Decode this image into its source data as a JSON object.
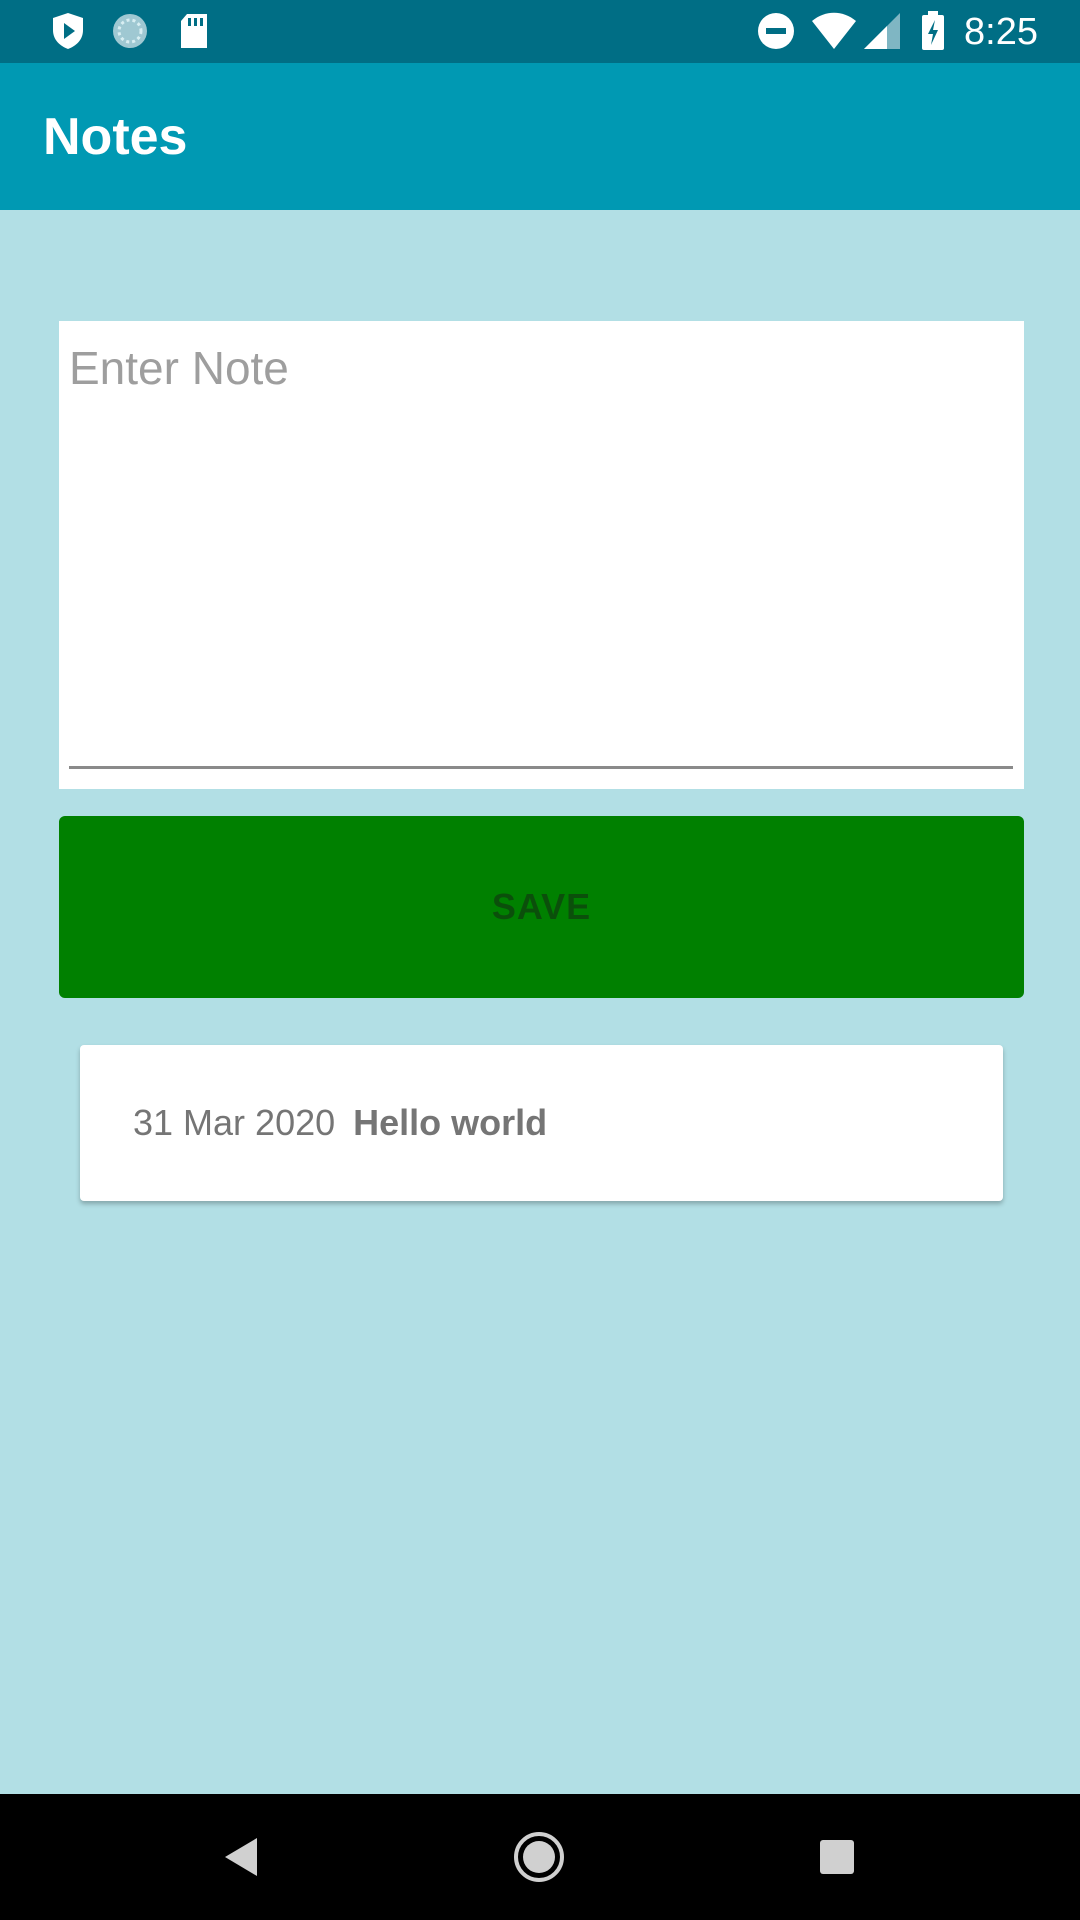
{
  "status_bar": {
    "time": "8:25",
    "left_icons": [
      "play-protect-icon",
      "sync-icon",
      "sd-card-icon"
    ],
    "right_icons": [
      "do-not-disturb-icon",
      "wifi-icon",
      "signal-icon",
      "battery-charging-icon"
    ]
  },
  "app_bar": {
    "title": "Notes"
  },
  "note_input": {
    "placeholder": "Enter Note",
    "value": ""
  },
  "save_button": {
    "label": "SAVE"
  },
  "notes_list": {
    "items": [
      {
        "date": "31 Mar 2020",
        "text": "Hello world"
      }
    ]
  },
  "nav_bar": {
    "icons": [
      "back-icon",
      "home-icon",
      "recents-icon"
    ]
  },
  "colors": {
    "status_bar": "#006e85",
    "app_bar": "#0099b3",
    "background": "#b2dfe5",
    "save_button": "#008000",
    "save_label": "#0b4f0b"
  }
}
